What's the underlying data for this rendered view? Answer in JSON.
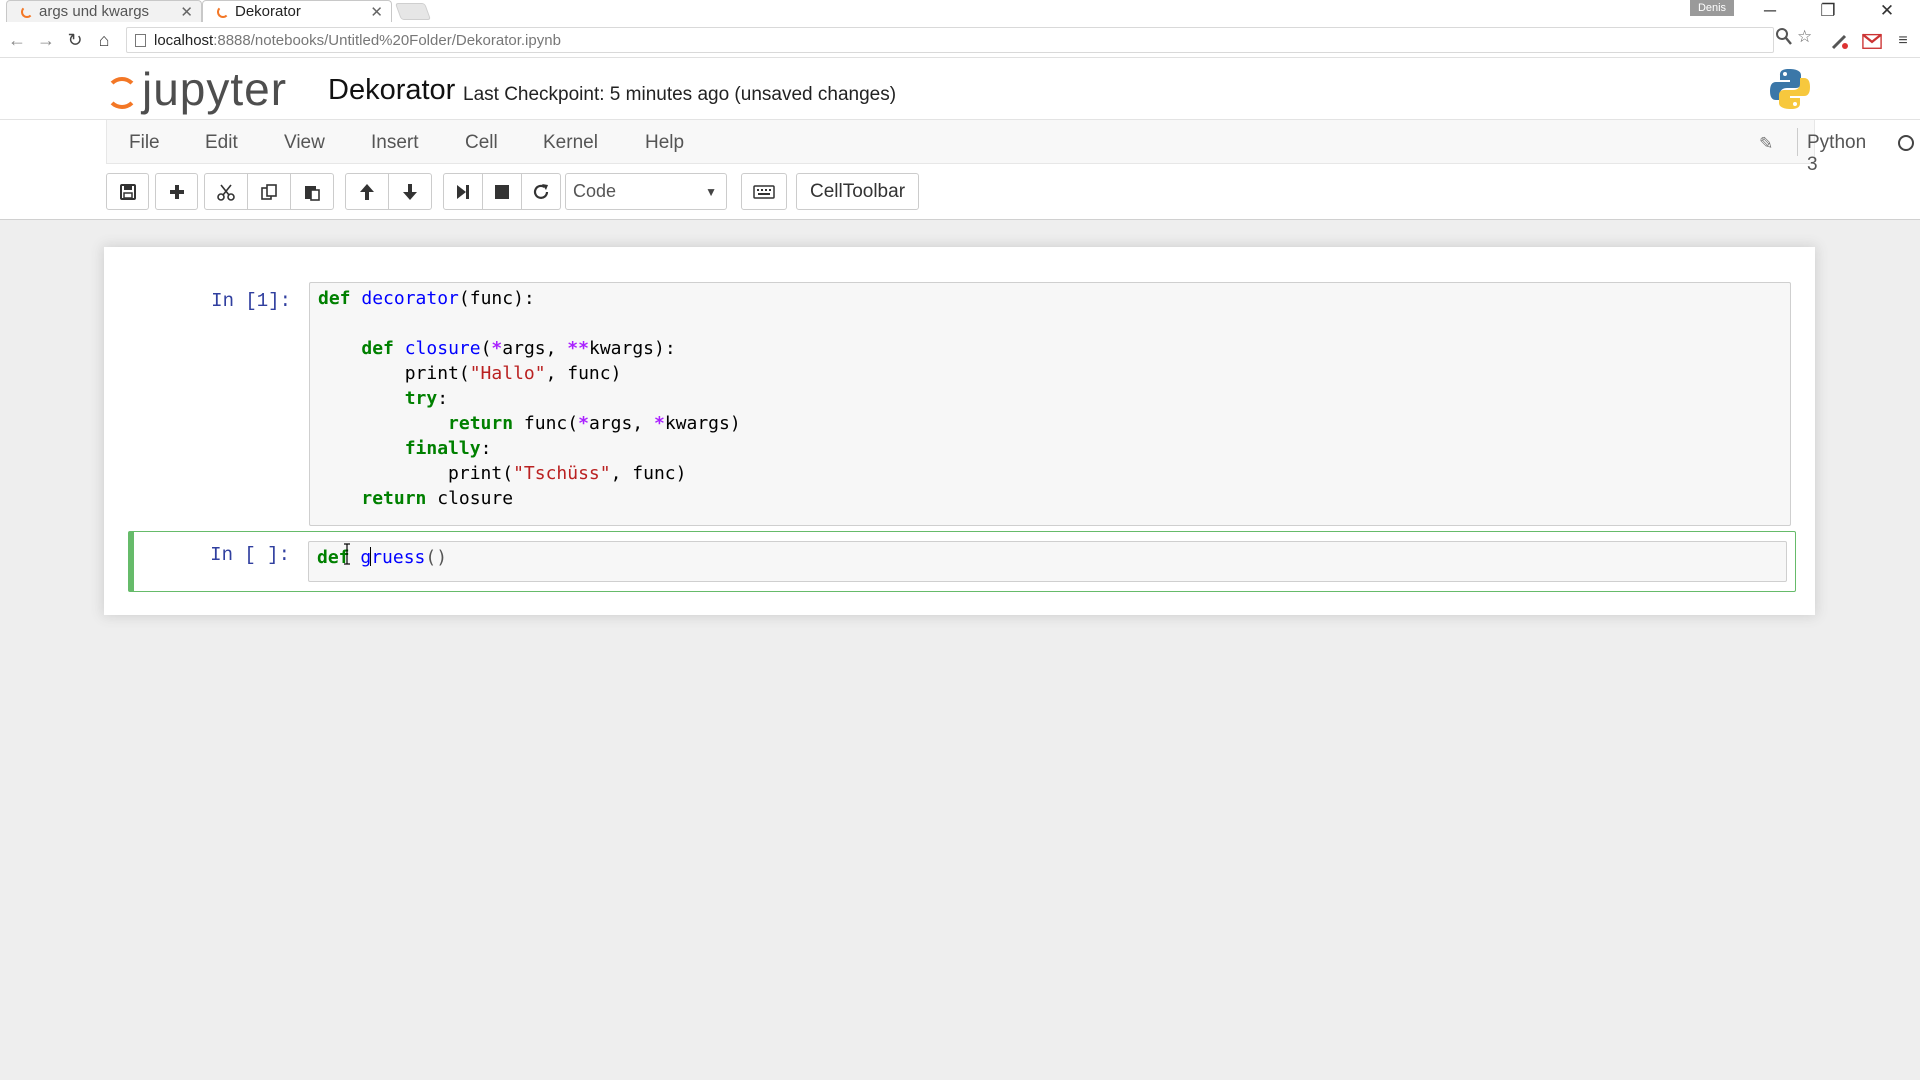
{
  "browser": {
    "tabs": [
      {
        "label": "args und kwargs",
        "active": false
      },
      {
        "label": "Dekorator",
        "active": true
      }
    ],
    "profile_badge": "Denis",
    "url_host": "localhost",
    "url_path": ":8888/notebooks/Untitled%20Folder/Dekorator.ipynb",
    "window_controls": {
      "minimize": "─",
      "restore": "❐",
      "close": "✕"
    }
  },
  "jupyter": {
    "logo_text": "jupyter",
    "notebook_name": "Dekorator",
    "checkpoint": "Last Checkpoint: 5 minutes ago (unsaved changes)",
    "menu": [
      "File",
      "Edit",
      "View",
      "Insert",
      "Cell",
      "Kernel",
      "Help"
    ],
    "kernel": "Python 3",
    "cell_type": "Code",
    "celltoolbar_label": "CellToolbar"
  },
  "cells": [
    {
      "prompt": "In [1]:",
      "code_lines": [
        "def decorator(func):",
        "",
        "    def closure(*args, **kwargs):",
        "        print(\"Hallo\", func)",
        "        try:",
        "            return func(*args, *kwargs)",
        "        finally:",
        "            print(\"Tschüss\", func)",
        "    return closure"
      ]
    },
    {
      "prompt": "In [ ]:",
      "code_lines": [
        "def gruess()"
      ],
      "selected": true
    }
  ],
  "colors": {
    "keyword": "#008000",
    "function_name": "#0000ff",
    "string": "#ba2121",
    "operator": "#aa22ff",
    "prompt": "#303f9f",
    "selected_cell_border": "#66bb6a",
    "jupyter_orange": "#f37726"
  },
  "icons": [
    "save-icon",
    "plus-icon",
    "cut-icon",
    "copy-icon",
    "paste-icon",
    "arrow-up-icon",
    "arrow-down-icon",
    "step-forward-icon",
    "stop-icon",
    "refresh-icon",
    "keyboard-icon",
    "pencil-icon",
    "python-logo-icon"
  ]
}
